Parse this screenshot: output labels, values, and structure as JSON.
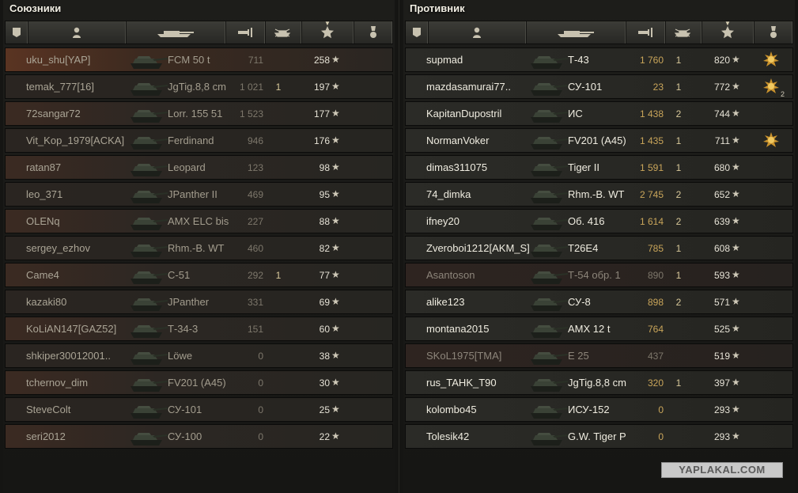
{
  "allies": {
    "title": "Союзники",
    "players": [
      {
        "name": "uku_shu[YAP]",
        "tank": "FCM 50 t",
        "damage": "711",
        "kills": "",
        "xp": "258"
      },
      {
        "name": "temak_777[16]",
        "tank": "JgTig.8,8 cm",
        "damage": "1 021",
        "kills": "1",
        "xp": "197"
      },
      {
        "name": "72sangar72",
        "tank": "Lorr. 155 51",
        "damage": "1 523",
        "kills": "",
        "xp": "177"
      },
      {
        "name": "Vit_Kop_1979[ACKA]",
        "tank": "Ferdinand",
        "damage": "946",
        "kills": "",
        "xp": "176"
      },
      {
        "name": "ratan87",
        "tank": "Leopard",
        "damage": "123",
        "kills": "",
        "xp": "98"
      },
      {
        "name": "leo_371",
        "tank": "JPanther II",
        "damage": "469",
        "kills": "",
        "xp": "95"
      },
      {
        "name": "OLENq",
        "tank": "AMX ELC bis",
        "damage": "227",
        "kills": "",
        "xp": "88"
      },
      {
        "name": "sergey_ezhov",
        "tank": "Rhm.-B. WT",
        "damage": "460",
        "kills": "",
        "xp": "82"
      },
      {
        "name": "Came4",
        "tank": "С-51",
        "damage": "292",
        "kills": "1",
        "xp": "77"
      },
      {
        "name": "kazaki80",
        "tank": "JPanther",
        "damage": "331",
        "kills": "",
        "xp": "69"
      },
      {
        "name": "KoLiAN147[GAZ52]",
        "tank": "Т-34-3",
        "damage": "151",
        "kills": "",
        "xp": "60"
      },
      {
        "name": "shkiper30012001..",
        "tank": "Löwe",
        "damage": "0",
        "kills": "",
        "xp": "38"
      },
      {
        "name": "tchernov_dim",
        "tank": "FV201 (A45)",
        "damage": "0",
        "kills": "",
        "xp": "30"
      },
      {
        "name": "SteveColt",
        "tank": "СУ-101",
        "damage": "0",
        "kills": "",
        "xp": "25"
      },
      {
        "name": "seri2012",
        "tank": "СУ-100",
        "damage": "0",
        "kills": "",
        "xp": "22"
      }
    ]
  },
  "enemies": {
    "title": "Противник",
    "players": [
      {
        "name": "supmad",
        "tank": "Т-43",
        "damage": "1 760",
        "kills": "1",
        "xp": "820",
        "medal": true,
        "medal_count": ""
      },
      {
        "name": "mazdasamurai77..",
        "tank": "СУ-101",
        "damage": "23",
        "kills": "1",
        "xp": "772",
        "medal": true,
        "medal_count": "2"
      },
      {
        "name": "KapitanDupostril",
        "tank": "ИС",
        "damage": "1 438",
        "kills": "2",
        "xp": "744"
      },
      {
        "name": "NormanVoker",
        "tank": "FV201 (A45)",
        "damage": "1 435",
        "kills": "1",
        "xp": "711",
        "medal": true,
        "medal_count": ""
      },
      {
        "name": "dimas311075",
        "tank": "Tiger II",
        "damage": "1 591",
        "kills": "1",
        "xp": "680"
      },
      {
        "name": "74_dimka",
        "tank": "Rhm.-B. WT",
        "damage": "2 745",
        "kills": "2",
        "xp": "652"
      },
      {
        "name": "ifney20",
        "tank": "Об. 416",
        "damage": "1 614",
        "kills": "2",
        "xp": "639"
      },
      {
        "name": "Zveroboi1212[AKM_S]",
        "tank": "T26E4",
        "damage": "785",
        "kills": "1",
        "xp": "608"
      },
      {
        "name": "Asantoson",
        "tank": "Т-54 обр. 1",
        "damage": "890",
        "kills": "1",
        "xp": "593",
        "dead": true
      },
      {
        "name": "alike123",
        "tank": "СУ-8",
        "damage": "898",
        "kills": "2",
        "xp": "571"
      },
      {
        "name": "montana2015",
        "tank": "AMX 12 t",
        "damage": "764",
        "kills": "",
        "xp": "525"
      },
      {
        "name": "SKoL1975[TMA]",
        "tank": "E 25",
        "damage": "437",
        "kills": "",
        "xp": "519",
        "dead": true
      },
      {
        "name": "rus_TAHK_T90",
        "tank": "JgTig.8,8 cm",
        "damage": "320",
        "kills": "1",
        "xp": "397"
      },
      {
        "name": "kolombo45",
        "tank": "ИСУ-152",
        "damage": "0",
        "kills": "",
        "xp": "293"
      },
      {
        "name": "Tolesik42",
        "tank": "G.W. Tiger P",
        "damage": "0",
        "kills": "",
        "xp": "293"
      }
    ]
  },
  "star_glyph": "★",
  "watermark": "YAPLAKAL.COM",
  "colors": {
    "medal": "#c9922d",
    "damage_enemy": "#c9a55a",
    "kills": "#d8c89a"
  }
}
